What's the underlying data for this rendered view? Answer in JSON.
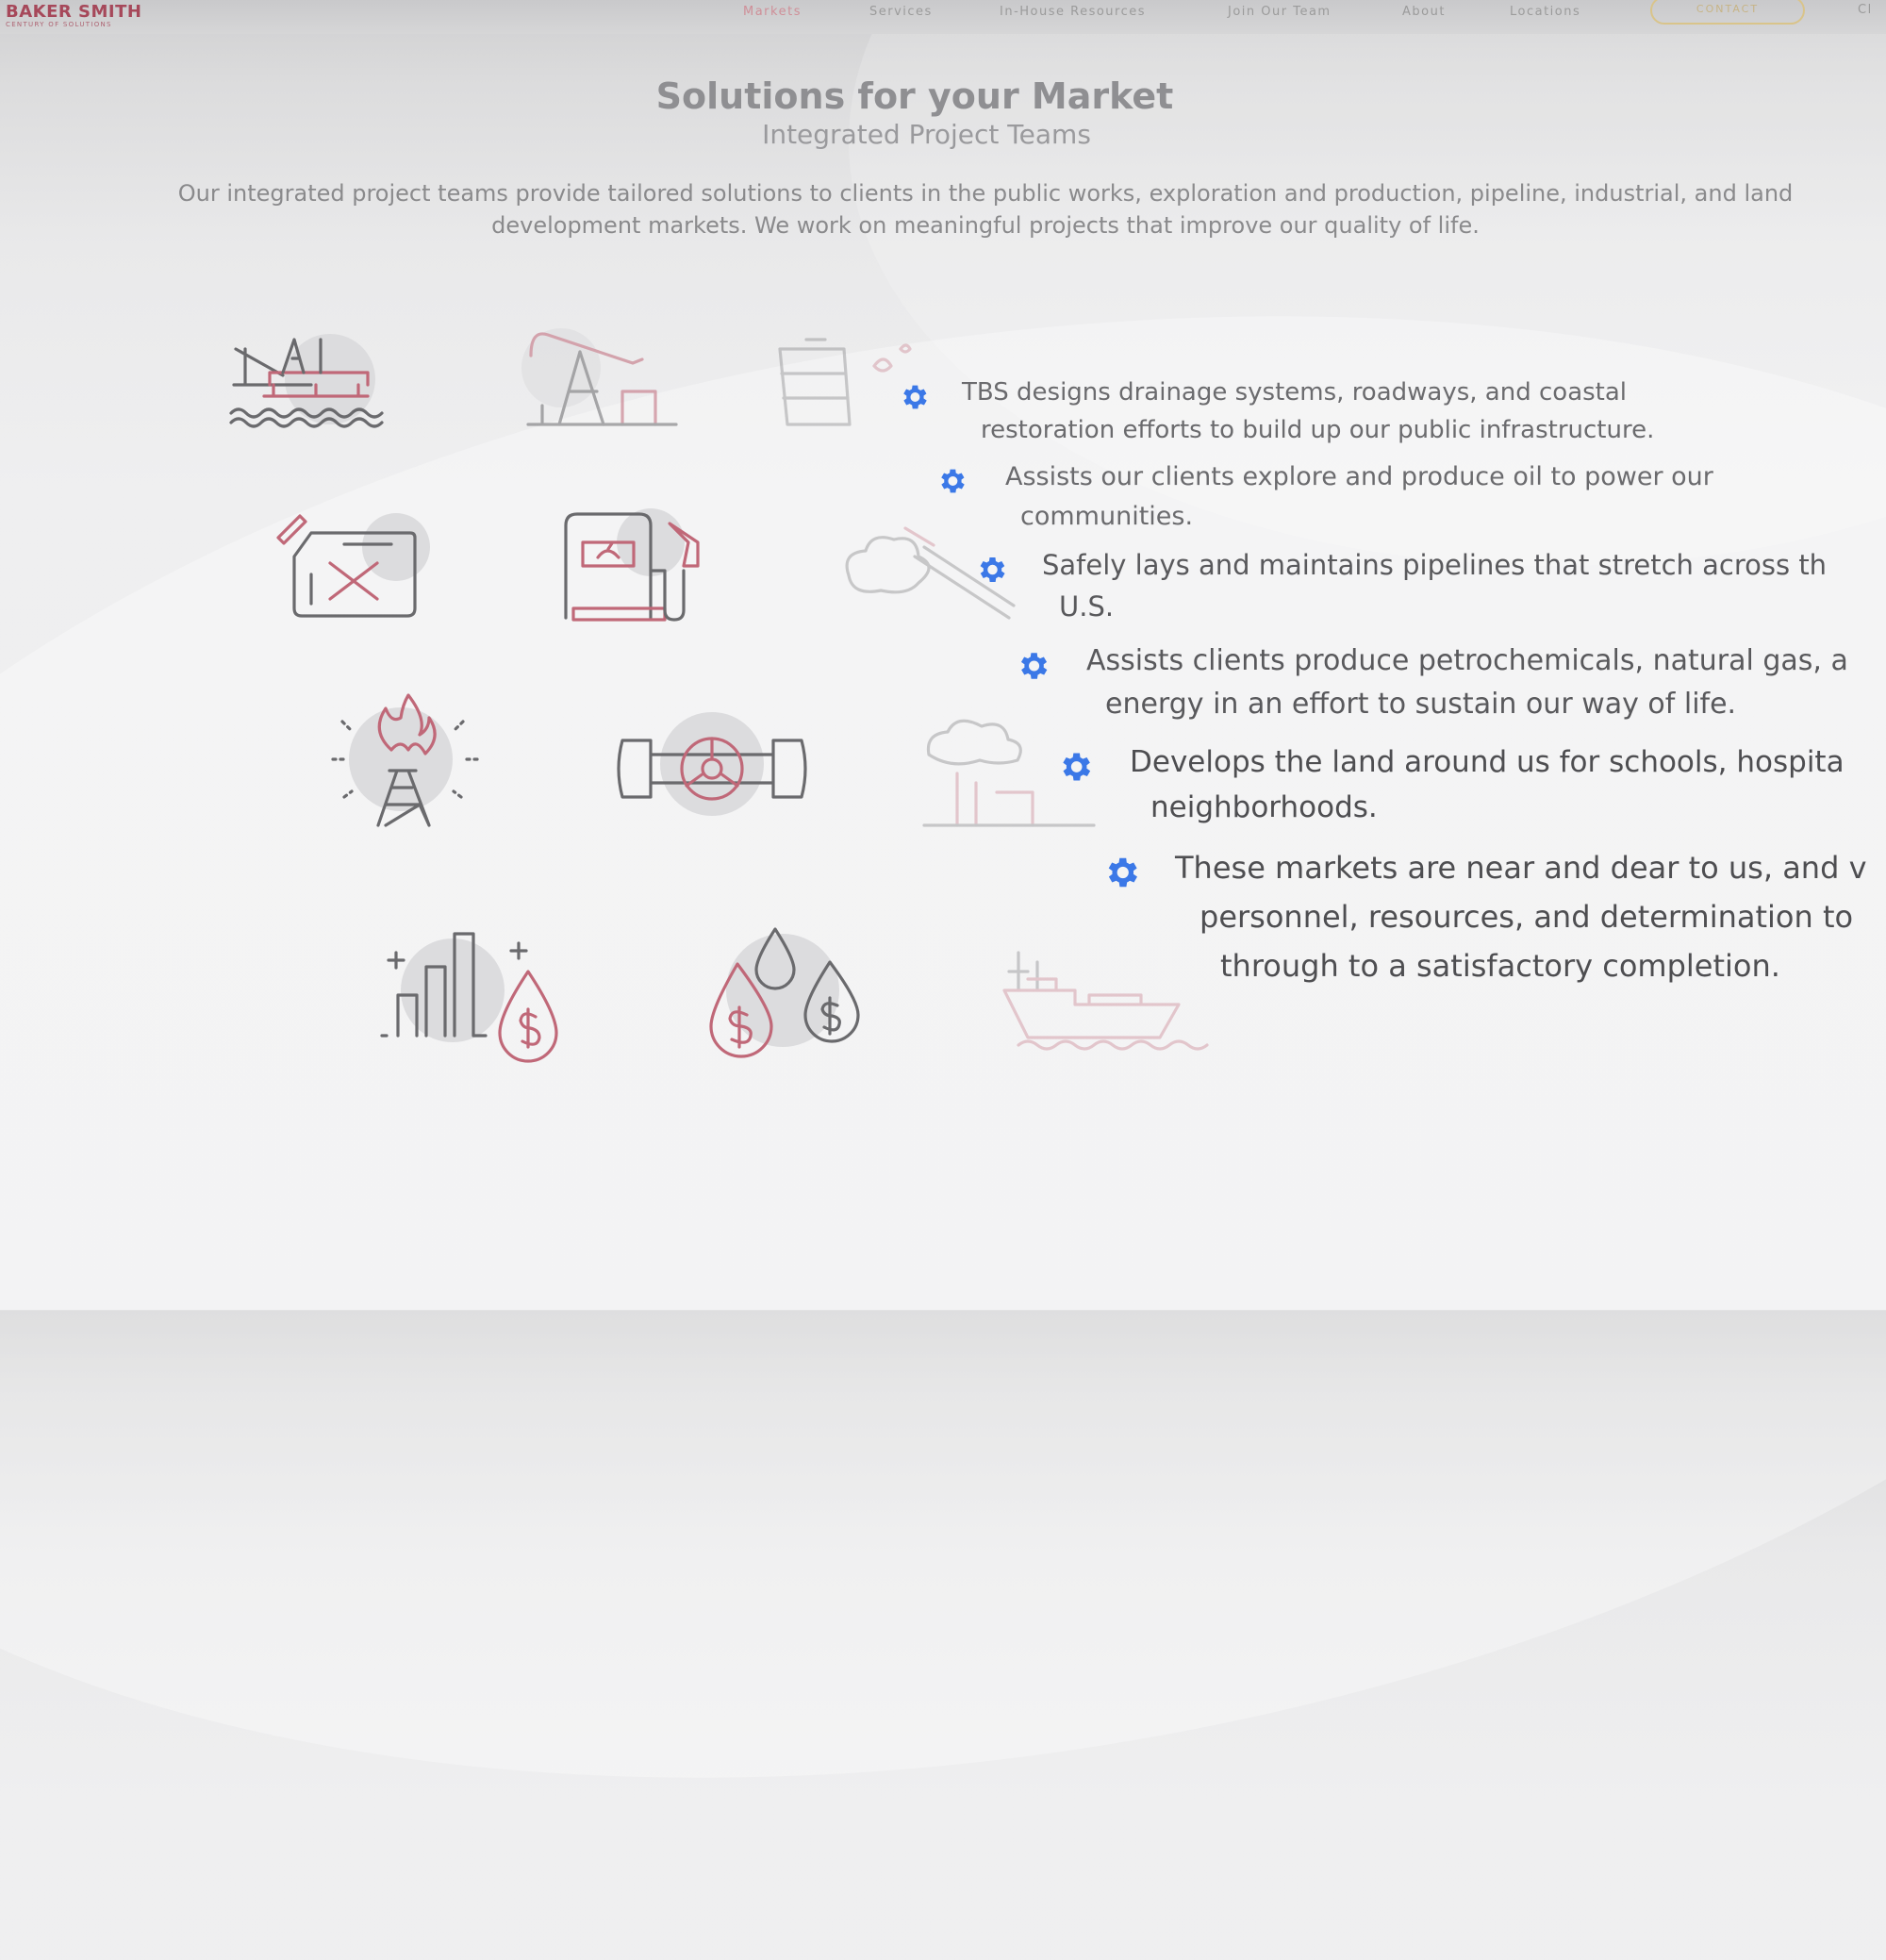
{
  "header": {
    "logo_name": "BAKER SMITH",
    "logo_tagline": "CENTURY OF SOLUTIONS",
    "nav": [
      {
        "label": "Markets",
        "active": true
      },
      {
        "label": "Services"
      },
      {
        "label": "In-House Resources"
      },
      {
        "label": "Join Our Team"
      },
      {
        "label": "About"
      },
      {
        "label": "Locations"
      }
    ],
    "contact_label": "CONTACT",
    "cut_off_label": "Cl"
  },
  "main": {
    "title": "Solutions for your Market",
    "subtitle": "Integrated Project Teams",
    "intro": "Our integrated project teams provide tailored solutions to clients in the public works, exploration and production, pipeline, industrial, and land development markets. We work on meaningful projects that improve our quality of life."
  },
  "icons": [
    "offshore-rig-icon",
    "pumpjack-icon",
    "oil-barrel-icon",
    "fuel-can-icon",
    "fuel-pump-icon",
    "pipe-wrench-icon",
    "gas-flare-icon",
    "pipeline-valve-icon",
    "factory-emissions-icon",
    "chart-oil-drop-icon",
    "oil-price-drops-icon",
    "tanker-ship-icon"
  ],
  "bullets": [
    {
      "line1": "TBS designs drainage systems, roadways, and coastal",
      "line2": "restoration efforts to build up our public infrastructure."
    },
    {
      "line1": "Assists our clients explore and produce oil to power our",
      "line2": "communities."
    },
    {
      "line1": "Safely lays and maintains pipelines that stretch across th",
      "line2": "U.S."
    },
    {
      "line1": "Assists clients produce petrochemicals, natural gas, a",
      "line2": "energy in an effort to sustain our way of life."
    },
    {
      "line1": "Develops the land around us for schools, hospita",
      "line2": "neighborhoods."
    },
    {
      "line1": "These markets are near and dear to us, and v",
      "line2": "personnel, resources, and determination to",
      "line3": "through to a satisfactory completion."
    }
  ],
  "colors": {
    "accent_red": "#c06878",
    "gear_blue": "#3b78e7",
    "logo_red": "#a6485a",
    "contact_gold": "#d9c48a"
  }
}
